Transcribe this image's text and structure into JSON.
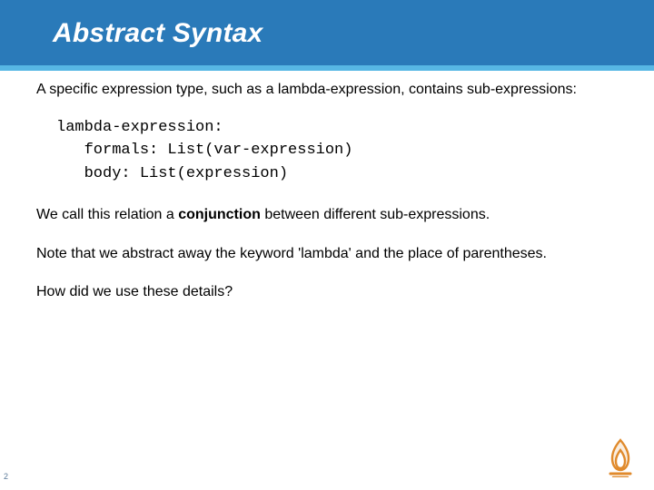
{
  "title": "Abstract Syntax",
  "intro": "A specific expression type, such as a lambda-expression, contains sub-expressions:",
  "code": {
    "line1": "lambda-expression:",
    "line2": "   formals: List(var-expression)",
    "line3": "   body: List(expression)"
  },
  "relation_pre": "We call this relation a ",
  "relation_bold": "conjunction",
  "relation_post": " between different sub-expressions.",
  "note": "Note that we abstract away the keyword 'lambda'  and the place of parentheses.",
  "question": "How did we use these details?",
  "page_number": "2",
  "colors": {
    "band": "#2a7ab9",
    "accent": "#57b7e4",
    "logo": "#e08a2c"
  }
}
